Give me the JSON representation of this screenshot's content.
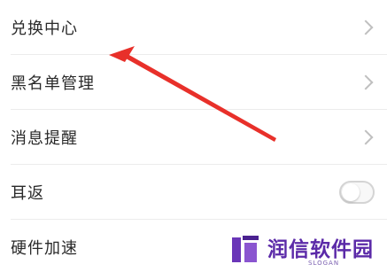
{
  "settings": {
    "items": [
      {
        "label": "兑换中心",
        "control": "chevron"
      },
      {
        "label": "黑名单管理",
        "control": "chevron"
      },
      {
        "label": "消息提醒",
        "control": "chevron"
      },
      {
        "label": "耳返",
        "control": "toggle",
        "toggle_on": false
      },
      {
        "label": "硬件加速",
        "control": "none"
      }
    ]
  },
  "annotation": {
    "arrow_color": "#e8302a"
  },
  "watermark": {
    "brand": "润信软件园",
    "slogan": "SLOGAN",
    "color": "#5b2aa8"
  }
}
